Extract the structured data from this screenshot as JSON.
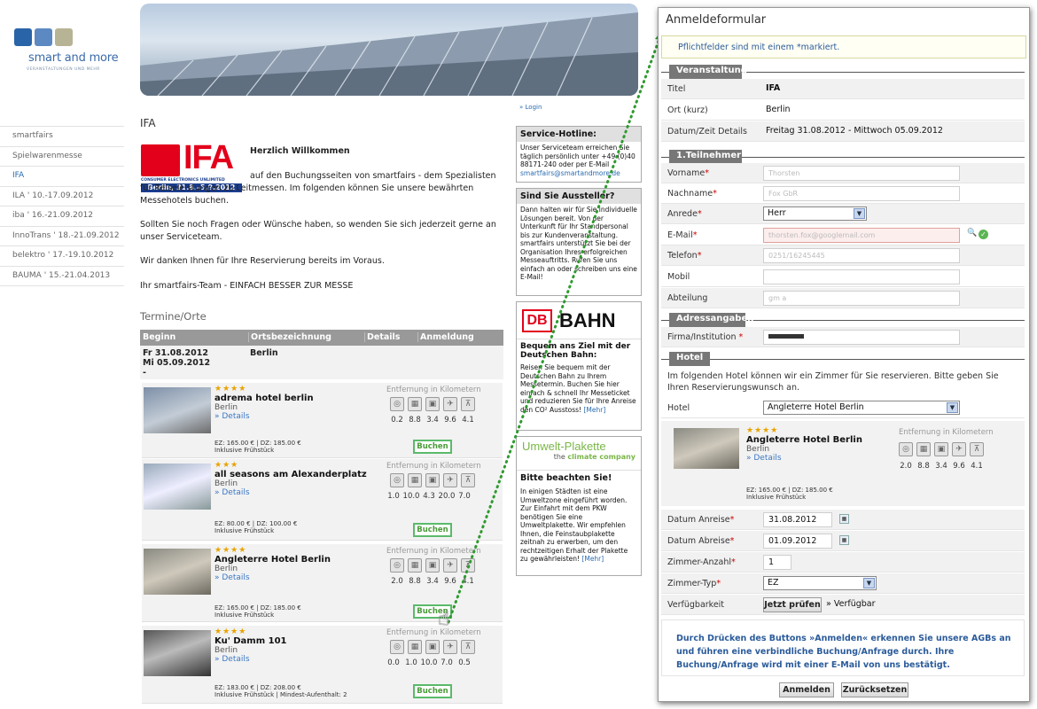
{
  "logo": {
    "name": "smart and more",
    "tagline": "VERANSTALTUNGEN UND MEHR",
    "colors": [
      "#2a64a8",
      "#5d89c2",
      "#b7b496"
    ]
  },
  "nav": {
    "items": [
      "smartfairs",
      "Spielwarenmesse",
      "IFA",
      "ILA ' 10.-17.09.2012",
      "iba ' 16.-21.09.2012",
      "InnoTrans ' 18.-21.09.2012",
      "belektro ' 17.-19.10.2012",
      "BAUMA ' 15.-21.04.2013"
    ],
    "active_index": 2
  },
  "login": "» Login",
  "main": {
    "title": "IFA",
    "ifa_logo": {
      "brand": "IFA",
      "sub": "CONSUMER ELECTRONICS UNLIMITED",
      "dates": "Berlin, 31.8.–5.9.2012"
    },
    "welcome": "Herzlich Willkommen",
    "p1": "auf den Buchungsseiten von smartfairs - dem Spezialisten für Reiseleistungen zu Leitmessen. Im folgenden können Sie unsere bewährten Messehotels buchen.",
    "p2": "Sollten Sie noch Fragen oder Wünsche haben, so wenden Sie sich jederzeit gerne an unser Serviceteam.",
    "p3": "Wir danken Ihnen für Ihre Reservierung bereits im Voraus.",
    "p4": "Ihr smartfairs-Team - EINFACH BESSER ZUR MESSE",
    "termine_title": "Termine/Orte",
    "table_headers": [
      "Beginn",
      "Ortsbezeichnung",
      "Details",
      "Anmeldung"
    ],
    "event": {
      "begin": "Fr 31.08.2012",
      "end": "Mi 05.09.2012",
      "dash": "-",
      "location": "Berlin"
    },
    "dist_header": "Entfernung in Kilometern",
    "details_label": "» Details",
    "book_label": "Buchen",
    "hotels": [
      {
        "stars": "★★★★",
        "name": "adrema hotel berlin",
        "city": "Berlin",
        "dist": [
          "0.2",
          "8.8",
          "3.4",
          "9.6",
          "4.1"
        ],
        "price": "EZ: 165.00 € | DZ: 185.00 €",
        "extra": "Inklusive Frühstück"
      },
      {
        "stars": "★★★",
        "name": "all seasons am Alexanderplatz",
        "city": "Berlin",
        "dist": [
          "1.0",
          "10.0",
          "4.3",
          "20.0",
          "7.0"
        ],
        "price": "EZ: 80.00 € | DZ: 100.00 €",
        "extra": "Inklusive Frühstück"
      },
      {
        "stars": "★★★★",
        "name": "Angleterre Hotel Berlin",
        "city": "Berlin",
        "dist": [
          "2.0",
          "8.8",
          "3.4",
          "9.6",
          "4.1"
        ],
        "price": "EZ: 165.00 € | DZ: 185.00 €",
        "extra": "Inklusive Frühstück"
      },
      {
        "stars": "★★★★",
        "name": "Ku' Damm 101",
        "city": "Berlin",
        "dist": [
          "0.0",
          "1.0",
          "10.0",
          "7.0",
          "0.5"
        ],
        "price": "EZ: 183.00 € | DZ: 208.00 €",
        "extra": "Inklusive Frühstück | Mindest-Aufenthalt: 2"
      }
    ]
  },
  "side": {
    "hotline_title": "Service-Hotline:",
    "hotline_text": "Unser Serviceteam erreichen Sie täglich persönlich unter +49 (0)40 88171-240 oder per E-Mail",
    "hotline_email": "smartfairs@smartandmore.de",
    "aussteller_title": "Sind Sie Aussteller?",
    "aussteller_text": "Dann halten wir für Sie individuelle Lösungen bereit. Von der Unterkunft für Ihr Standpersonal bis zur Kundenveranstaltung. smartfairs unterstützt Sie bei der Organisation Ihres erfolgreichen Messeauftritts. Rufen Sie uns einfach an oder schreiben uns eine E-Mail!",
    "db_logo": "DB",
    "bahn_logo": "BAHN",
    "bahn_title": "Bequem ans Ziel mit der Deutschen Bahn:",
    "bahn_text": "Reisen Sie bequem mit der Deutschen Bahn zu Ihrem Messetermin. Buchen Sie hier einfach & schnell Ihr Messeticket und reduzieren Sie für Ihre Anreise den CO² Ausstoss!",
    "mehr": "[Mehr]",
    "umwelt_logo": "Umwelt-Plakette",
    "umwelt_sub1": "the",
    "umwelt_sub2": "climate company",
    "umwelt_title": "Bitte beachten Sie!",
    "umwelt_text": "In einigen Städten ist eine Umweltzone eingeführt worden. Zur Einfahrt mit dem PKW benötigen Sie eine Umweltplakette. Wir empfehlen Ihnen, die Feinstaubplakette zeitnah zu erwerben, um den rechtzeitigen Erhalt der Plakette zu gewährleisten!"
  },
  "form": {
    "title": "Anmeldeformular",
    "required_note": "Pflichtfelder sind mit einem  *markiert.",
    "sec_event": "Veranstaltung",
    "titel_label": "Titel",
    "titel_value": "IFA",
    "ort_label": "Ort (kurz)",
    "ort_value": "Berlin",
    "datum_label": "Datum/Zeit Details",
    "datum_value": "Freitag 31.08.2012  - Mittwoch 05.09.2012",
    "sec_person": "1.Teilnehmer",
    "vorname_label": "Vorname",
    "vorname_value": "Thorsten",
    "nachname_label": "Nachname",
    "nachname_value": "Fox GbR",
    "anrede_label": "Anrede",
    "anrede_value": "Herr",
    "email_label": "E-Mail",
    "email_value": "thorsten.fox@googlemail.com",
    "telefon_label": "Telefon",
    "telefon_value": "0251/16245445",
    "mobil_label": "Mobil",
    "abteilung_label": "Abteilung",
    "abteilung_value": "gm a",
    "sec_address": "Adressangaben",
    "firma_label": "Firma/Institution",
    "sec_hotel": "Hotel",
    "hotel_text": "Im folgenden Hotel können wir ein Zimmer für Sie reservieren. Bitte geben Sie Ihren Reservierungswunsch an.",
    "hotel_label": "Hotel",
    "hotel_value": "Angleterre Hotel Berlin",
    "hotel_card": {
      "stars": "★★★★",
      "name": "Angleterre Hotel Berlin",
      "city": "Berlin",
      "details": "» Details",
      "dist_header": "Entfernung in Kilometern",
      "dist": [
        "2.0",
        "8.8",
        "3.4",
        "9.6",
        "4.1"
      ],
      "price": "EZ: 165.00 € | DZ: 185.00 €",
      "extra": "Inklusive Frühstück"
    },
    "anreise_label": "Datum Anreise",
    "anreise_value": "31.08.2012",
    "abreise_label": "Datum Abreise",
    "abreise_value": "01.09.2012",
    "anzahl_label": "Zimmer-Anzahl",
    "anzahl_value": "1",
    "typ_label": "Zimmer-Typ",
    "typ_value": "EZ",
    "verf_label": "Verfügbarkeit",
    "verf_button": "Jetzt prüfen",
    "verf_text": "» Verfügbar",
    "agb_note": "Durch Drücken des Buttons »Anmelden« erkennen Sie unsere AGBs an und führen eine verbindliche Buchung/Anfrage durch. Ihre Buchung/Anfrage wird mit einer E-Mail von uns bestätigt.",
    "submit": "Anmelden",
    "reset": "Zurücksetzen"
  },
  "colors": {
    "link": "#2b6cb0",
    "green": "#5aba6a",
    "req": "#cc0000"
  }
}
